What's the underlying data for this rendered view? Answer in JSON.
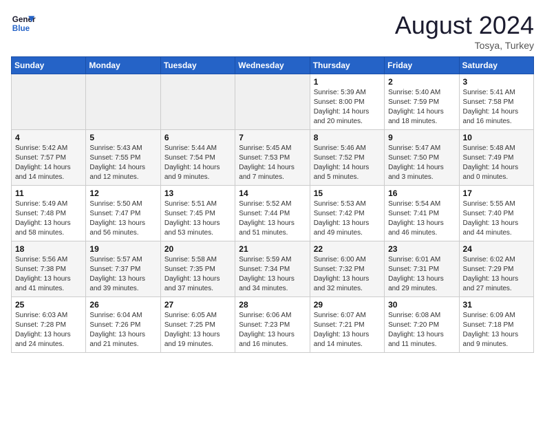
{
  "header": {
    "logo_line1": "General",
    "logo_line2": "Blue",
    "month_title": "August 2024",
    "subtitle": "Tosya, Turkey"
  },
  "weekdays": [
    "Sunday",
    "Monday",
    "Tuesday",
    "Wednesday",
    "Thursday",
    "Friday",
    "Saturday"
  ],
  "weeks": [
    [
      {
        "day": "",
        "empty": true
      },
      {
        "day": "",
        "empty": true
      },
      {
        "day": "",
        "empty": true
      },
      {
        "day": "",
        "empty": true
      },
      {
        "day": "1",
        "sunrise": "Sunrise: 5:39 AM",
        "sunset": "Sunset: 8:00 PM",
        "daylight": "Daylight: 14 hours and 20 minutes."
      },
      {
        "day": "2",
        "sunrise": "Sunrise: 5:40 AM",
        "sunset": "Sunset: 7:59 PM",
        "daylight": "Daylight: 14 hours and 18 minutes."
      },
      {
        "day": "3",
        "sunrise": "Sunrise: 5:41 AM",
        "sunset": "Sunset: 7:58 PM",
        "daylight": "Daylight: 14 hours and 16 minutes."
      }
    ],
    [
      {
        "day": "4",
        "sunrise": "Sunrise: 5:42 AM",
        "sunset": "Sunset: 7:57 PM",
        "daylight": "Daylight: 14 hours and 14 minutes."
      },
      {
        "day": "5",
        "sunrise": "Sunrise: 5:43 AM",
        "sunset": "Sunset: 7:55 PM",
        "daylight": "Daylight: 14 hours and 12 minutes."
      },
      {
        "day": "6",
        "sunrise": "Sunrise: 5:44 AM",
        "sunset": "Sunset: 7:54 PM",
        "daylight": "Daylight: 14 hours and 9 minutes."
      },
      {
        "day": "7",
        "sunrise": "Sunrise: 5:45 AM",
        "sunset": "Sunset: 7:53 PM",
        "daylight": "Daylight: 14 hours and 7 minutes."
      },
      {
        "day": "8",
        "sunrise": "Sunrise: 5:46 AM",
        "sunset": "Sunset: 7:52 PM",
        "daylight": "Daylight: 14 hours and 5 minutes."
      },
      {
        "day": "9",
        "sunrise": "Sunrise: 5:47 AM",
        "sunset": "Sunset: 7:50 PM",
        "daylight": "Daylight: 14 hours and 3 minutes."
      },
      {
        "day": "10",
        "sunrise": "Sunrise: 5:48 AM",
        "sunset": "Sunset: 7:49 PM",
        "daylight": "Daylight: 14 hours and 0 minutes."
      }
    ],
    [
      {
        "day": "11",
        "sunrise": "Sunrise: 5:49 AM",
        "sunset": "Sunset: 7:48 PM",
        "daylight": "Daylight: 13 hours and 58 minutes."
      },
      {
        "day": "12",
        "sunrise": "Sunrise: 5:50 AM",
        "sunset": "Sunset: 7:47 PM",
        "daylight": "Daylight: 13 hours and 56 minutes."
      },
      {
        "day": "13",
        "sunrise": "Sunrise: 5:51 AM",
        "sunset": "Sunset: 7:45 PM",
        "daylight": "Daylight: 13 hours and 53 minutes."
      },
      {
        "day": "14",
        "sunrise": "Sunrise: 5:52 AM",
        "sunset": "Sunset: 7:44 PM",
        "daylight": "Daylight: 13 hours and 51 minutes."
      },
      {
        "day": "15",
        "sunrise": "Sunrise: 5:53 AM",
        "sunset": "Sunset: 7:42 PM",
        "daylight": "Daylight: 13 hours and 49 minutes."
      },
      {
        "day": "16",
        "sunrise": "Sunrise: 5:54 AM",
        "sunset": "Sunset: 7:41 PM",
        "daylight": "Daylight: 13 hours and 46 minutes."
      },
      {
        "day": "17",
        "sunrise": "Sunrise: 5:55 AM",
        "sunset": "Sunset: 7:40 PM",
        "daylight": "Daylight: 13 hours and 44 minutes."
      }
    ],
    [
      {
        "day": "18",
        "sunrise": "Sunrise: 5:56 AM",
        "sunset": "Sunset: 7:38 PM",
        "daylight": "Daylight: 13 hours and 41 minutes."
      },
      {
        "day": "19",
        "sunrise": "Sunrise: 5:57 AM",
        "sunset": "Sunset: 7:37 PM",
        "daylight": "Daylight: 13 hours and 39 minutes."
      },
      {
        "day": "20",
        "sunrise": "Sunrise: 5:58 AM",
        "sunset": "Sunset: 7:35 PM",
        "daylight": "Daylight: 13 hours and 37 minutes."
      },
      {
        "day": "21",
        "sunrise": "Sunrise: 5:59 AM",
        "sunset": "Sunset: 7:34 PM",
        "daylight": "Daylight: 13 hours and 34 minutes."
      },
      {
        "day": "22",
        "sunrise": "Sunrise: 6:00 AM",
        "sunset": "Sunset: 7:32 PM",
        "daylight": "Daylight: 13 hours and 32 minutes."
      },
      {
        "day": "23",
        "sunrise": "Sunrise: 6:01 AM",
        "sunset": "Sunset: 7:31 PM",
        "daylight": "Daylight: 13 hours and 29 minutes."
      },
      {
        "day": "24",
        "sunrise": "Sunrise: 6:02 AM",
        "sunset": "Sunset: 7:29 PM",
        "daylight": "Daylight: 13 hours and 27 minutes."
      }
    ],
    [
      {
        "day": "25",
        "sunrise": "Sunrise: 6:03 AM",
        "sunset": "Sunset: 7:28 PM",
        "daylight": "Daylight: 13 hours and 24 minutes."
      },
      {
        "day": "26",
        "sunrise": "Sunrise: 6:04 AM",
        "sunset": "Sunset: 7:26 PM",
        "daylight": "Daylight: 13 hours and 21 minutes."
      },
      {
        "day": "27",
        "sunrise": "Sunrise: 6:05 AM",
        "sunset": "Sunset: 7:25 PM",
        "daylight": "Daylight: 13 hours and 19 minutes."
      },
      {
        "day": "28",
        "sunrise": "Sunrise: 6:06 AM",
        "sunset": "Sunset: 7:23 PM",
        "daylight": "Daylight: 13 hours and 16 minutes."
      },
      {
        "day": "29",
        "sunrise": "Sunrise: 6:07 AM",
        "sunset": "Sunset: 7:21 PM",
        "daylight": "Daylight: 13 hours and 14 minutes."
      },
      {
        "day": "30",
        "sunrise": "Sunrise: 6:08 AM",
        "sunset": "Sunset: 7:20 PM",
        "daylight": "Daylight: 13 hours and 11 minutes."
      },
      {
        "day": "31",
        "sunrise": "Sunrise: 6:09 AM",
        "sunset": "Sunset: 7:18 PM",
        "daylight": "Daylight: 13 hours and 9 minutes."
      }
    ]
  ]
}
